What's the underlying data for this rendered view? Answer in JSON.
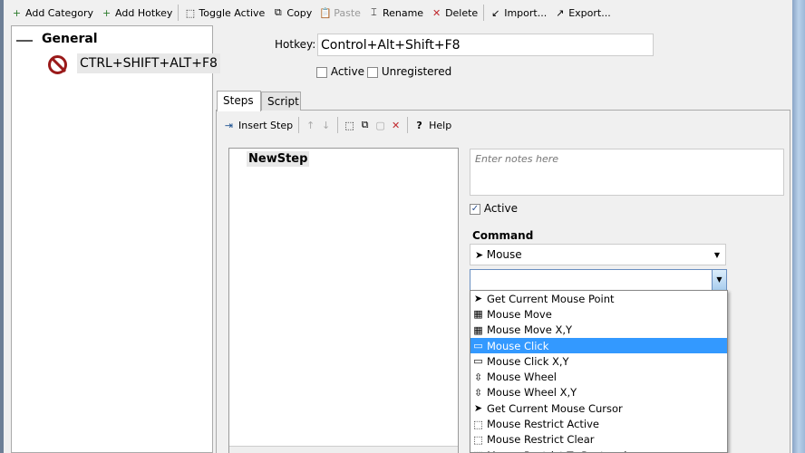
{
  "toolbar": {
    "items": [
      {
        "label": "Add Category",
        "icon": "add-category-icon",
        "enabled": true
      },
      {
        "label": "Add Hotkey",
        "icon": "add-hotkey-icon",
        "enabled": true
      },
      {
        "label": "Toggle Active",
        "icon": "toggle-active-icon",
        "enabled": true
      },
      {
        "label": "Copy",
        "icon": "copy-icon",
        "enabled": true
      },
      {
        "label": "Paste",
        "icon": "paste-icon",
        "enabled": false
      },
      {
        "label": "Rename",
        "icon": "rename-icon",
        "enabled": true
      },
      {
        "label": "Delete",
        "icon": "delete-icon",
        "enabled": true
      },
      {
        "label": "Import...",
        "icon": "import-icon",
        "enabled": true
      },
      {
        "label": "Export...",
        "icon": "export-icon",
        "enabled": true
      }
    ]
  },
  "tree": {
    "category": "General",
    "hotkey": "CTRL+SHIFT+ALT+F8"
  },
  "hotkey": {
    "label": "Hotkey:",
    "value": "Control+Alt+Shift+F8",
    "active_label": "Active",
    "active": false,
    "unregistered_label": "Unregistered",
    "unregistered": false
  },
  "tabs": [
    {
      "label": "Steps",
      "selected": true
    },
    {
      "label": "Script",
      "selected": false
    }
  ],
  "steps_toolbar": {
    "insert": "Insert Step",
    "help": "Help"
  },
  "steps": [
    "NewStep"
  ],
  "step": {
    "notes_placeholder": "Enter notes here",
    "active_label": "Active",
    "active": true,
    "command_label": "Command",
    "command_value": "Mouse",
    "subcommand_value": ""
  },
  "dropdown": {
    "selected": "Mouse Click",
    "items": [
      "Get Current Mouse Point",
      "Mouse Move",
      "Mouse Move X,Y",
      "Mouse Click",
      "Mouse Click X,Y",
      "Mouse Wheel",
      "Mouse Wheel X,Y",
      "Get Current Mouse Cursor",
      "Mouse Restrict Active",
      "Mouse Restrict Clear",
      "Mouse Restrict To Rectangle"
    ]
  },
  "colors": {
    "selection": "#3399ff",
    "delete": "#c0282d"
  }
}
